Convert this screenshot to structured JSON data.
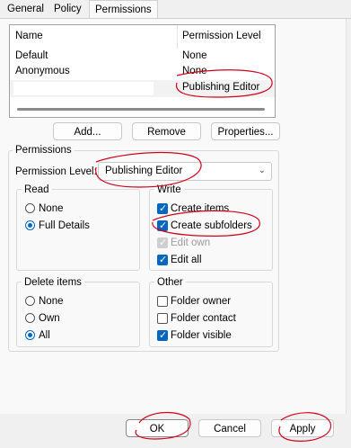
{
  "tabs": [
    "General",
    "Policy",
    "Permissions"
  ],
  "list": {
    "col_name": "Name",
    "col_level": "Permission Level",
    "rows": [
      {
        "name": "Default",
        "level": "None"
      },
      {
        "name": "Anonymous",
        "level": "None"
      },
      {
        "name": "",
        "level": "Publishing Editor"
      }
    ]
  },
  "buttons": {
    "add": "Add...",
    "remove": "Remove",
    "properties": "Properties..."
  },
  "permissions": {
    "title": "Permissions",
    "level_label": "Permission Level:",
    "level_value": "Publishing Editor"
  },
  "read": {
    "title": "Read",
    "options": [
      "None",
      "Full Details"
    ],
    "selected": "Full Details"
  },
  "write": {
    "title": "Write",
    "items": [
      {
        "label": "Create items",
        "checked": true,
        "disabled": false
      },
      {
        "label": "Create subfolders",
        "checked": true,
        "disabled": false
      },
      {
        "label": "Edit own",
        "checked": true,
        "disabled": true
      },
      {
        "label": "Edit all",
        "checked": true,
        "disabled": false
      }
    ]
  },
  "delete": {
    "title": "Delete items",
    "options": [
      "None",
      "Own",
      "All"
    ],
    "selected": "All"
  },
  "other": {
    "title": "Other",
    "items": [
      {
        "label": "Folder owner",
        "checked": false
      },
      {
        "label": "Folder contact",
        "checked": false
      },
      {
        "label": "Folder visible",
        "checked": true
      }
    ]
  },
  "footer": {
    "ok": "OK",
    "cancel": "Cancel",
    "apply": "Apply"
  },
  "colors": {
    "accent": "#0067c0",
    "annotation": "#d0021b"
  }
}
